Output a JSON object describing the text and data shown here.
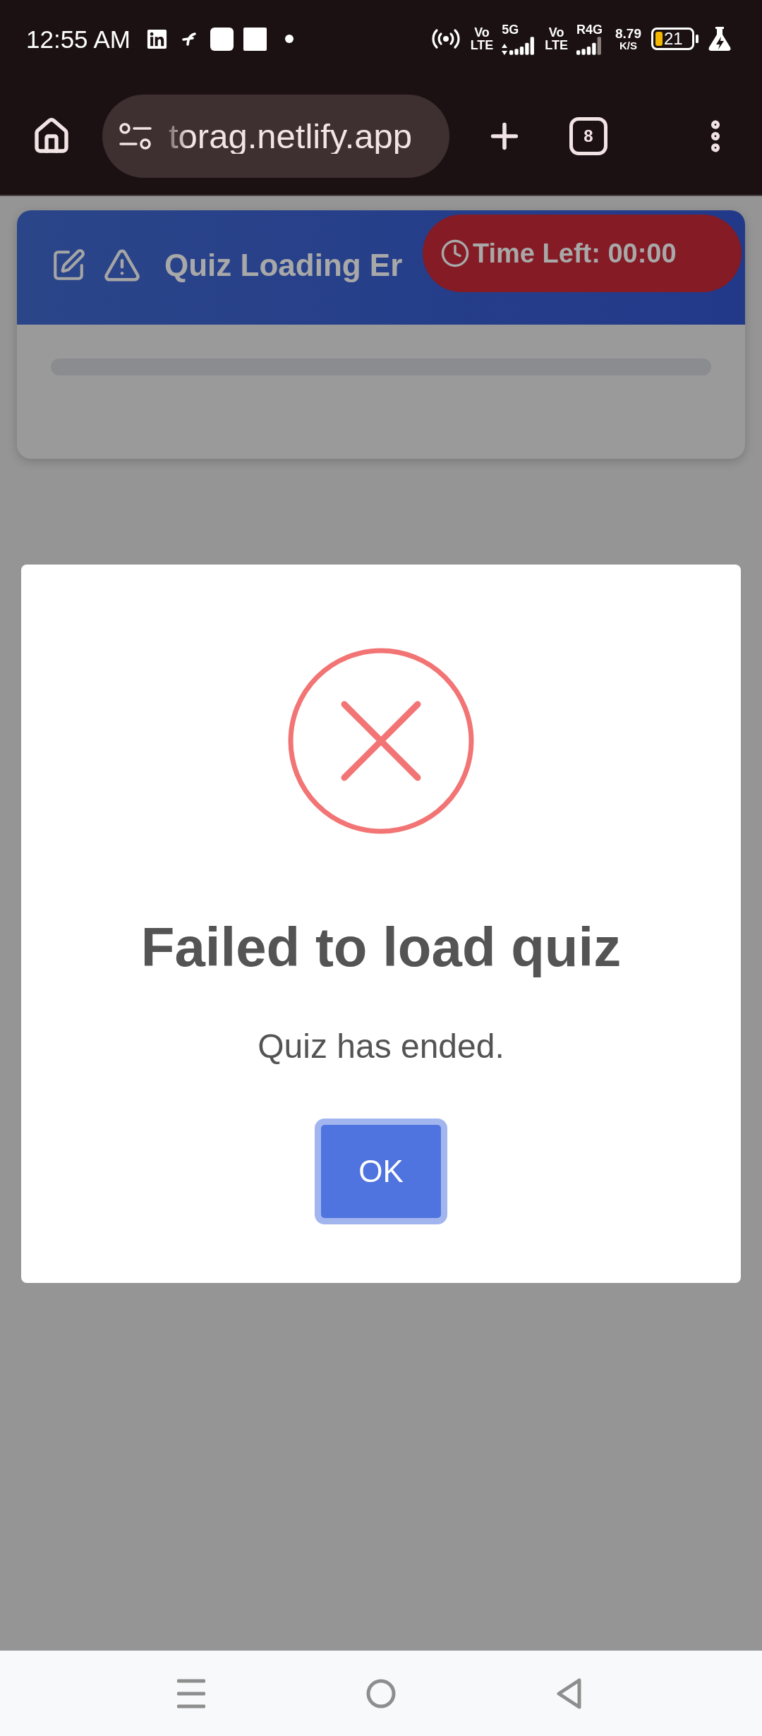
{
  "status_bar": {
    "time": "12:55 AM",
    "sims": [
      {
        "volte": [
          "Vo",
          "LTE"
        ],
        "network": "5G",
        "data_active": true
      },
      {
        "volte": [
          "Vo",
          "LTE"
        ],
        "network": "R4G",
        "data_active": false
      }
    ],
    "speed": [
      "8.79",
      "K/S"
    ],
    "battery": "21"
  },
  "browser_bar": {
    "url": "torag.netlify.app",
    "tab_count": "8"
  },
  "quiz_header": {
    "title": "Quiz Loading Er",
    "timer": "Time Left: 00:00"
  },
  "dialog": {
    "title": "Failed to load quiz",
    "message": "Quiz has ended.",
    "button": "OK"
  }
}
